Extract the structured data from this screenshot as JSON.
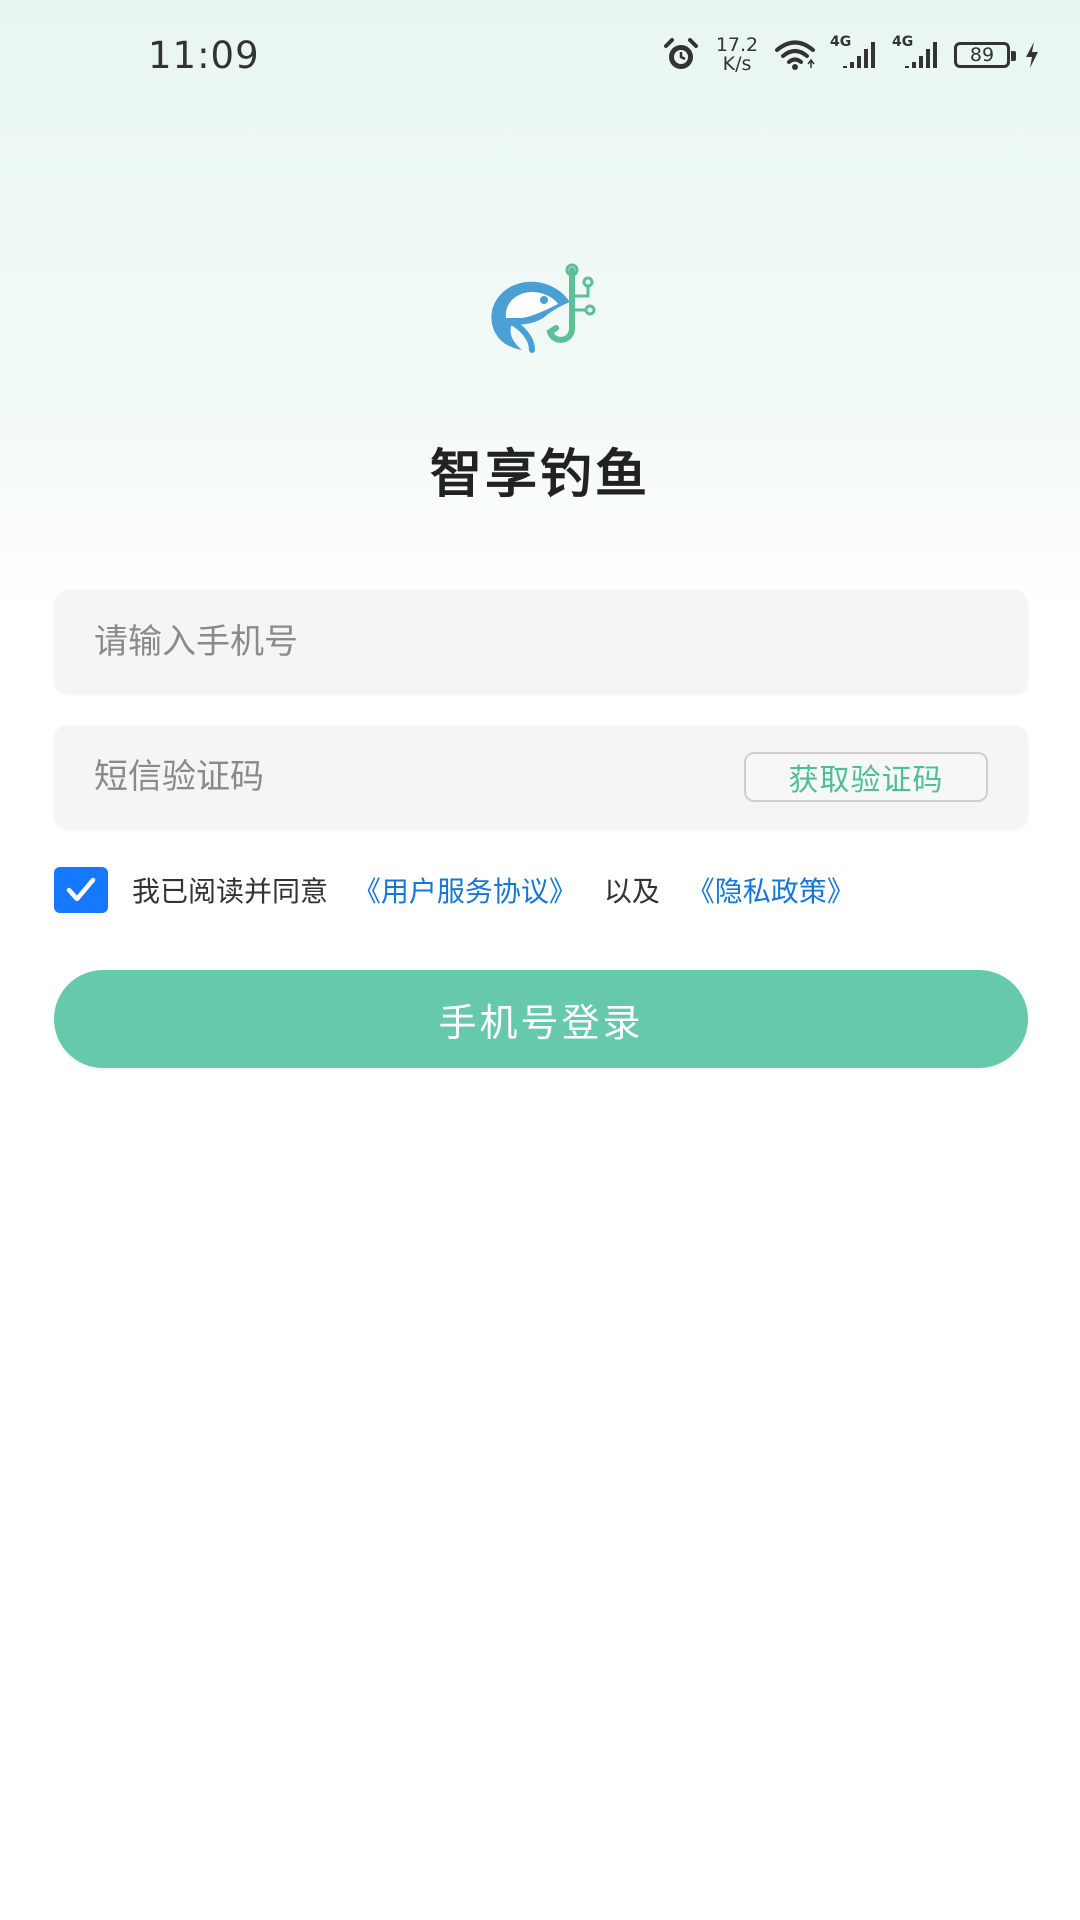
{
  "status_bar": {
    "time": "11:09",
    "net_speed_value": "17.2",
    "net_speed_unit": "K/s",
    "signal_1": "4G",
    "signal_2": "4G",
    "battery": "89"
  },
  "app": {
    "title": "智享钓鱼",
    "logo_icon": "fish-hook-logo-icon"
  },
  "form": {
    "phone_placeholder": "请输入手机号",
    "phone_value": "",
    "code_placeholder": "短信验证码",
    "code_value": "",
    "get_code_label": "获取验证码"
  },
  "agreement": {
    "checked": true,
    "prefix": "我已阅读并同意",
    "user_agreement": "《用户服务协议》",
    "and": "以及",
    "privacy_policy": "《隐私政策》"
  },
  "login_button": "手机号登录",
  "colors": {
    "accent_green": "#67c9ab",
    "link_blue": "#1677d9",
    "checkbox_blue": "#1677ff",
    "code_text_green": "#4cbf96"
  }
}
